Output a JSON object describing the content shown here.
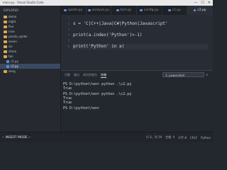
{
  "window": {
    "title": "main.py - Visual Studio Code",
    "controls": [
      "—",
      "☐",
      "✕"
    ]
  },
  "sidebar": {
    "header": "EXPLORER",
    "items": [
      {
        "label": "demo",
        "type": "folder"
      },
      {
        "label": "eight",
        "type": "folder"
      },
      {
        "label": "five",
        "type": "folder"
      },
      {
        "label": "nine",
        "type": "folder"
      },
      {
        "label": "panda_spider",
        "type": "folder"
      },
      {
        "label": "seven",
        "type": "folder"
      },
      {
        "label": "six",
        "type": "folder"
      },
      {
        "label": "stone",
        "type": "folder"
      },
      {
        "label": "ten",
        "type": "folder"
      },
      {
        "label": "c1.py",
        "type": "file",
        "sub": true
      },
      {
        "label": "c2.py",
        "type": "file",
        "sub": true,
        "active": true
      },
      {
        "label": "zeng",
        "type": "folder"
      }
    ]
  },
  "tabs": [
    {
      "label": "spider.py"
    },
    {
      "label": "analyse.py"
    },
    {
      "label": "test.py"
    },
    {
      "label": "config.py"
    },
    {
      "label": "c1.py"
    },
    {
      "label": "c2.py",
      "active": true
    }
  ],
  "editor": {
    "lines": [
      {
        "num": "1",
        "text": ""
      },
      {
        "num": "2",
        "text": "s = 'C|C++|Java|C#|Python|Javascript'"
      },
      {
        "num": "3",
        "text": ""
      },
      {
        "num": "4",
        "text": "print(a.index('Python')>-1)"
      },
      {
        "num": "5",
        "text": ""
      },
      {
        "num": "6",
        "text": "print('Python' in a)"
      }
    ]
  },
  "panel": {
    "tabs": [
      "问题",
      "输出",
      "调试控制台",
      "终端"
    ],
    "active_tab": "终端",
    "terminal_select": "1: powershell",
    "terminal_lines": [
      "PS D:\\python\\ten> python .\\c2.py",
      "True",
      "PS D:\\python\\ten> python .\\c2.py",
      "True",
      "True",
      "PS D:\\python\\ten> "
    ]
  },
  "status": {
    "mode": "-- INSERT MODE --",
    "position": "行 6，列 19",
    "spaces": "空格: 4",
    "encoding": "UTF-8",
    "eol": "CRLF",
    "language": "Python"
  }
}
